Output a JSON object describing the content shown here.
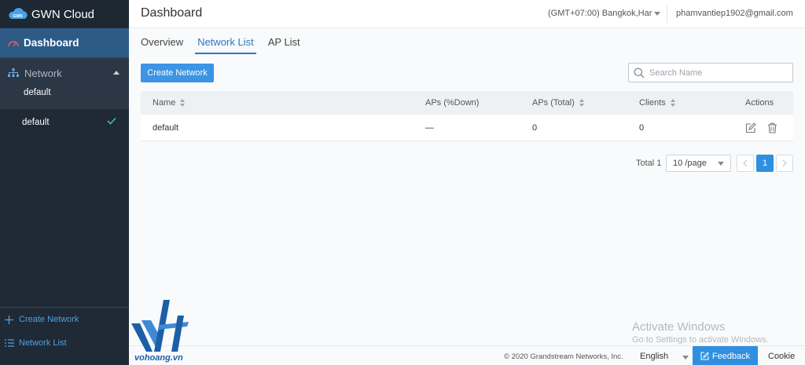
{
  "brand": {
    "logo_text": "GWN",
    "name": "GWN Cloud"
  },
  "sidebar": {
    "dashboard_label": "Dashboard",
    "network_label": "Network",
    "network_sub_item": "default",
    "networks": [
      {
        "label": "default",
        "selected": true
      }
    ],
    "bottom_links": [
      {
        "label": "Create Network"
      },
      {
        "label": "Network List"
      }
    ]
  },
  "header": {
    "title": "Dashboard",
    "timezone": "(GMT+07:00) Bangkok,Har",
    "user_email": "phamvantiep1902@gmail.com"
  },
  "tabs": [
    {
      "label": "Overview",
      "active": false
    },
    {
      "label": "Network List",
      "active": true
    },
    {
      "label": "AP List",
      "active": false
    }
  ],
  "toolbar": {
    "create_label": "Create Network",
    "search_placeholder": "Search Name",
    "search_value": ""
  },
  "table": {
    "columns": [
      "Name",
      "APs (%Down)",
      "APs (Total)",
      "Clients",
      "Actions"
    ],
    "rows": [
      {
        "name": "default",
        "aps_down": "—",
        "aps_total": "0",
        "clients": "0"
      }
    ]
  },
  "pagination": {
    "total_label": "Total 1",
    "page_size": "10 /page",
    "current_page": "1"
  },
  "footer": {
    "copyright": "© 2020 Grandstream Networks, Inc.",
    "language": "English",
    "feedback": "Feedback",
    "cookie": "Cookie"
  },
  "overlay": {
    "activate_title": "Activate Windows",
    "activate_sub": "Go to Settings to activate Windows.",
    "watermark": "vohoang.vn"
  },
  "colors": {
    "accent": "#2f8fe0",
    "sidebar_bg": "#1f2a36",
    "active_item_bg": "#2e5a86",
    "check": "#4cc27d"
  }
}
